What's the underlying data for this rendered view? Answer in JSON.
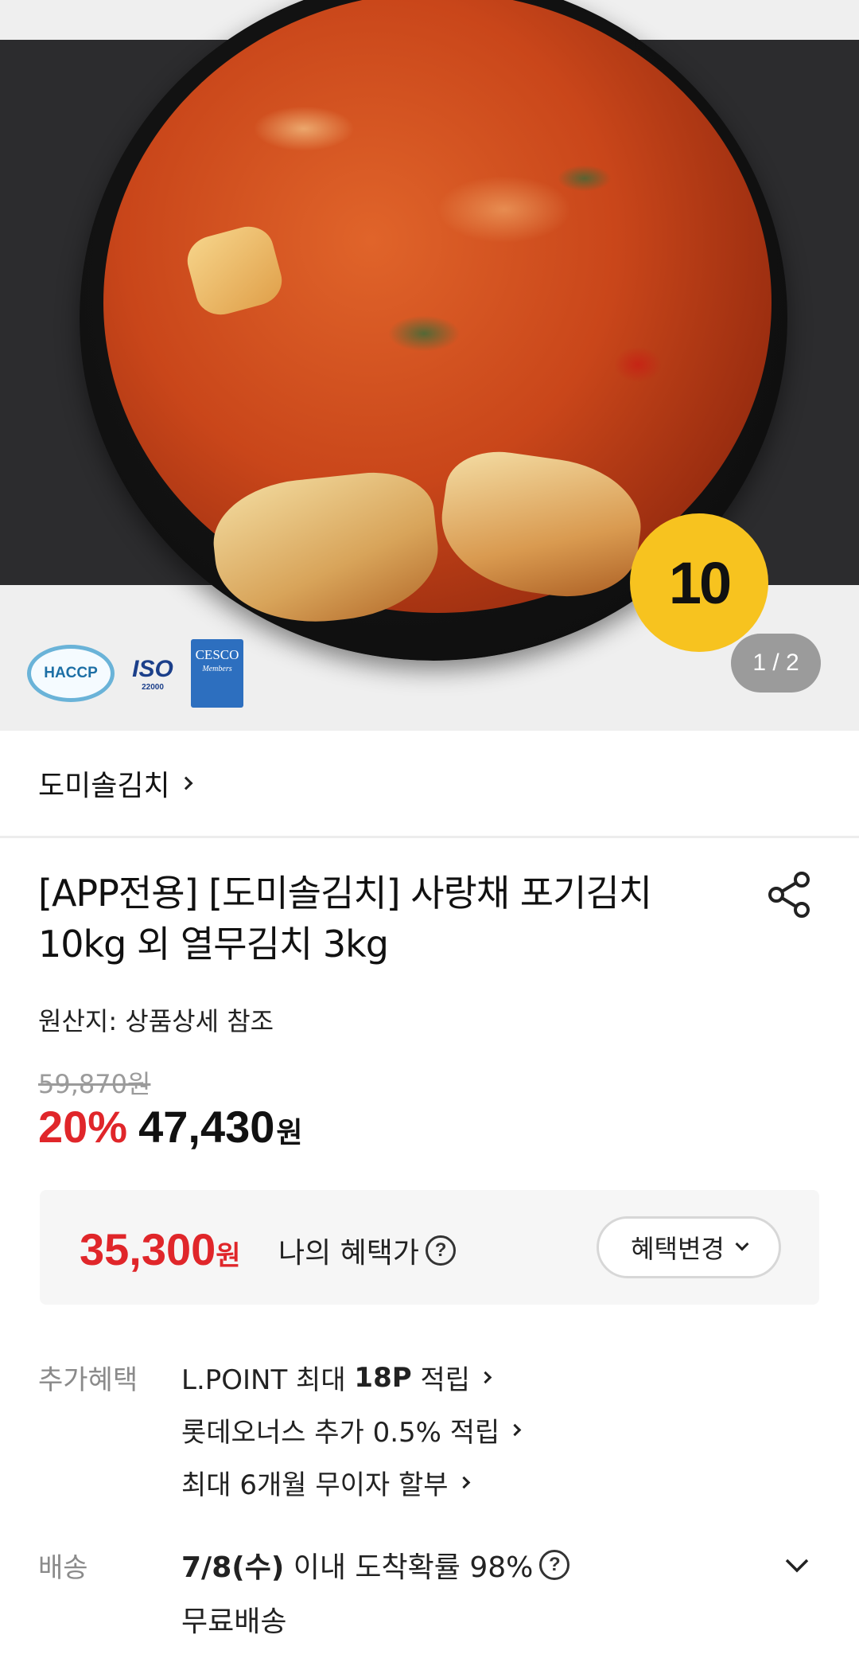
{
  "hero": {
    "count_badge": "10",
    "pager": "1 / 2",
    "certs": {
      "haccp": "HACCP",
      "iso": "ISO",
      "iso_num": "22000",
      "cesco": "CESCO",
      "cesco_sub": "Members"
    }
  },
  "store": {
    "name": "도미솔김치"
  },
  "product": {
    "title": "[APP전용] [도미솔김치] 사랑채 포기김치 10kg 외 열무김치 3kg",
    "origin": "원산지: 상품상세 참조"
  },
  "price": {
    "original": "59,870원",
    "discount": "20%",
    "sale": "47,430",
    "sale_unit": "원"
  },
  "benefit": {
    "price": "35,300",
    "unit": "원",
    "label": "나의 혜택가",
    "help": "?",
    "change_button": "혜택변경"
  },
  "additional": {
    "label": "추가혜택",
    "lines": [
      {
        "prefix": "L.POINT 최대 ",
        "bold": "18P",
        "suffix": " 적립"
      },
      {
        "text": "롯데오너스 추가 0.5% 적립"
      },
      {
        "text": "최대 6개월 무이자 할부"
      }
    ]
  },
  "shipping": {
    "label": "배송",
    "date": "7/8(수)",
    "info": " 이내 도착확률 98%",
    "help": "?",
    "free": "무료배송"
  }
}
